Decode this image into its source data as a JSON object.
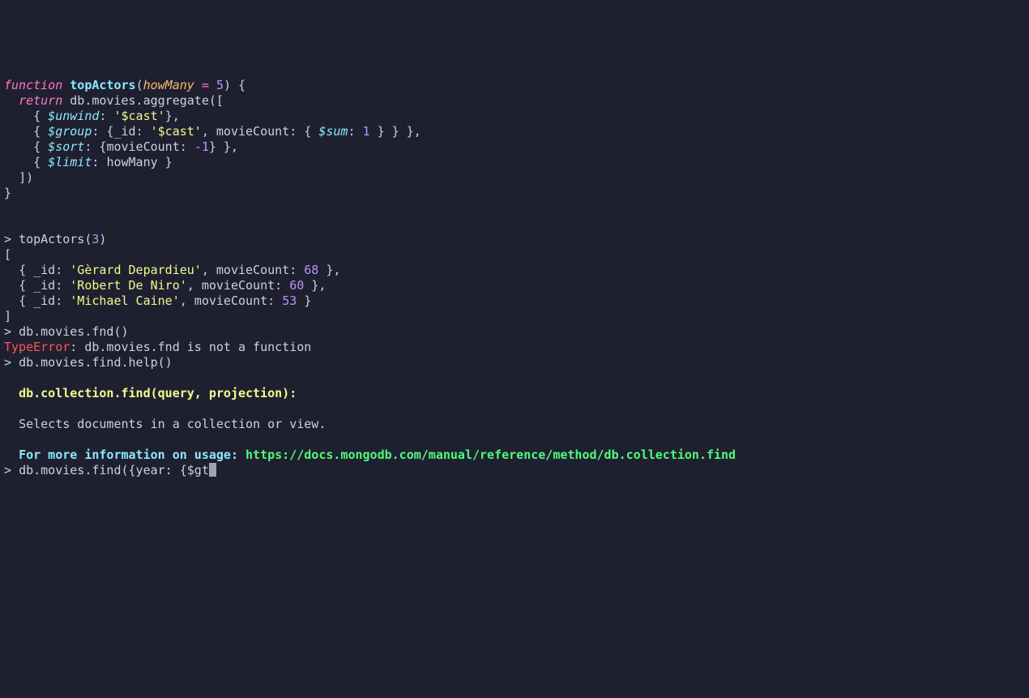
{
  "func": {
    "keyword": "function",
    "name": "topActors",
    "paramName": "howMany",
    "eq": "=",
    "defaultVal": "5",
    "open": ") {",
    "return": "return",
    "agg": "db.movies.aggregate([",
    "unwind": "$unwind",
    "castStr": "'$cast'",
    "group": "$group",
    "idKey": "_id",
    "castStr2": "'$cast'",
    "movieCountKey": "movieCount",
    "sum": "$sum",
    "sumVal": "1",
    "sort": "$sort",
    "sortField": "movieCount",
    "sortDir": "-1",
    "limit": "$limit",
    "limitVal": "howMany",
    "close1": "])",
    "close2": "}"
  },
  "call": {
    "prompt": ">",
    "fn": "topActors",
    "arg": "3",
    "openBracket": "[",
    "rows": [
      {
        "id": "'Gèrard Depardieu'",
        "count": "68",
        "trailComma": ","
      },
      {
        "id": "'Robert De Niro'",
        "count": "60",
        "trailComma": ","
      },
      {
        "id": "'Michael Caine'",
        "count": "53",
        "trailComma": ""
      }
    ],
    "closeBracket": "]"
  },
  "typo": {
    "prompt": ">",
    "cmd": "db.movies.fnd()",
    "errType": "TypeError",
    "errMsg": ": db.movies.fnd is not a function"
  },
  "help": {
    "prompt": ">",
    "cmd": "db.movies.find.help()",
    "sig": "db.collection.find(query, projection):",
    "desc": "Selects documents in a collection or view.",
    "moreLabel": "For more information on usage:",
    "url": "https://docs.mongodb.com/manual/reference/method/db.collection.find"
  },
  "typing": {
    "prompt": ">",
    "text": "db.movies.find({year: {$gt"
  }
}
